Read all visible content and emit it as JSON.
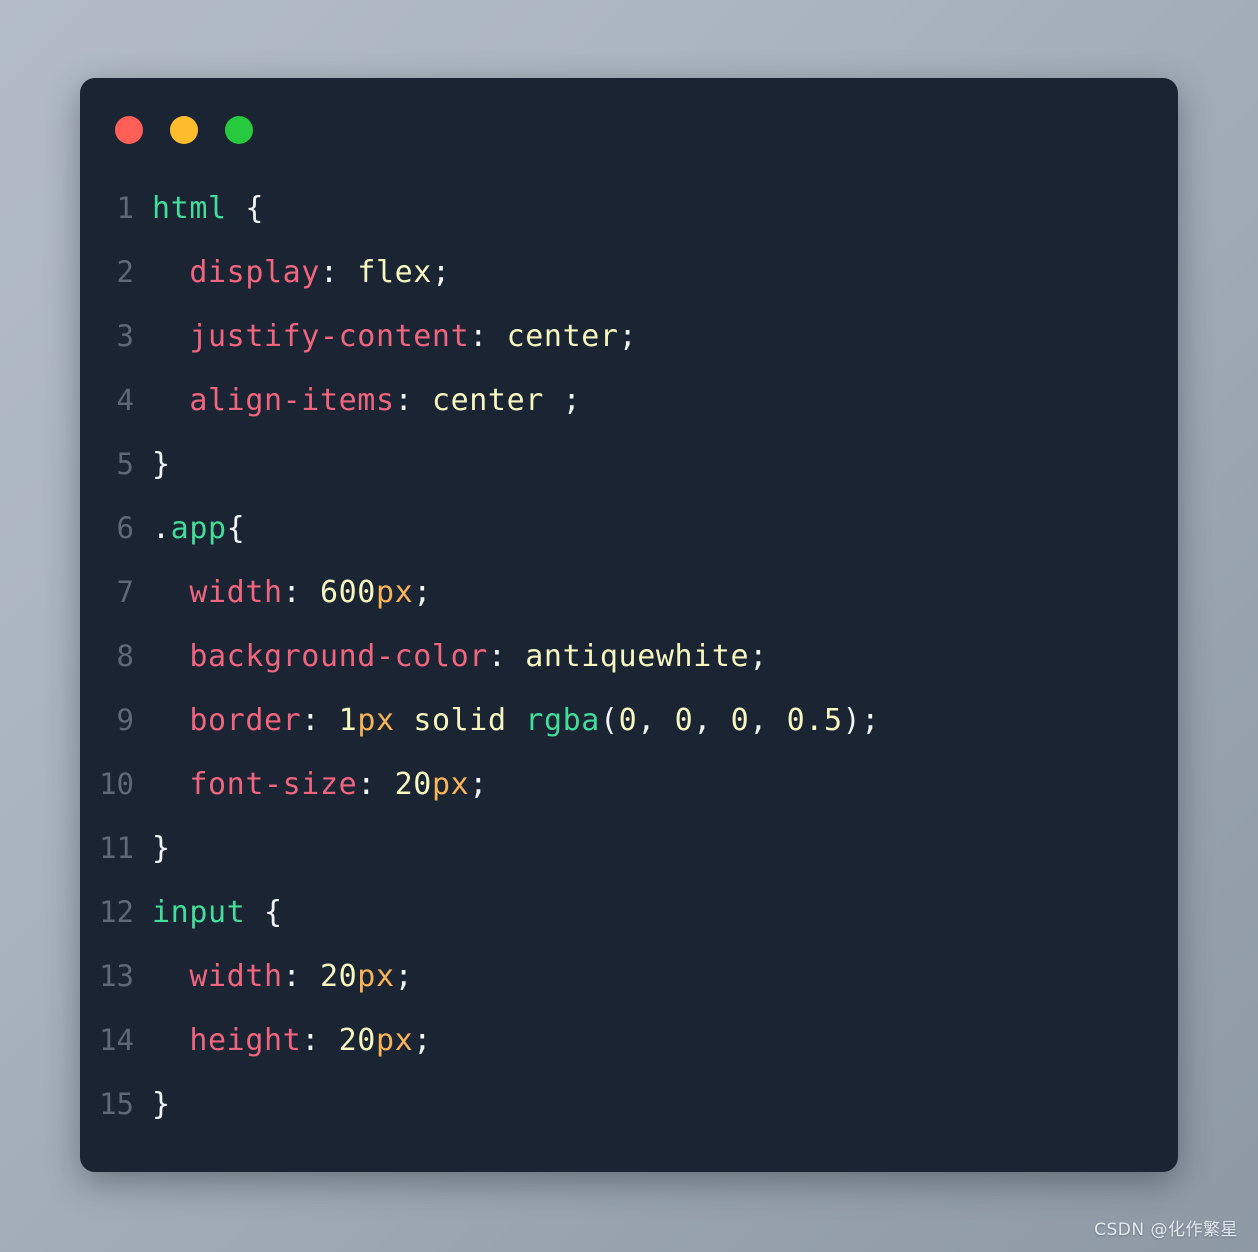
{
  "window": {
    "title_bar": {
      "dots": [
        {
          "name": "close-dot",
          "color": "#ff5f56"
        },
        {
          "name": "minimize-dot",
          "color": "#ffbd2e"
        },
        {
          "name": "maximize-dot",
          "color": "#27c93f"
        }
      ]
    },
    "background_color": "#1b2433",
    "page_background_color": "#a9b3be"
  },
  "syntax_colors": {
    "selector": "#43dd9b",
    "property": "#f0657e",
    "value": "#f6f8c0",
    "unit": "#f9b457",
    "function": "#43dd9b",
    "punctuation": "#f2f5f7",
    "line_number": "#5d6878"
  },
  "editor": {
    "language": "css",
    "lines": [
      {
        "number": "1",
        "plain": "html {",
        "tokens": [
          {
            "t": "html",
            "c": "tok-sel"
          },
          {
            "t": " {",
            "c": "tok-punc"
          }
        ]
      },
      {
        "number": "2",
        "plain": "  display: flex;",
        "tokens": [
          {
            "t": "  ",
            "c": "tok-plain"
          },
          {
            "t": "display",
            "c": "tok-prop"
          },
          {
            "t": ": ",
            "c": "tok-punc"
          },
          {
            "t": "flex",
            "c": "tok-val"
          },
          {
            "t": ";",
            "c": "tok-punc"
          }
        ]
      },
      {
        "number": "3",
        "plain": "  justify-content: center;",
        "tokens": [
          {
            "t": "  ",
            "c": "tok-plain"
          },
          {
            "t": "justify-content",
            "c": "tok-prop"
          },
          {
            "t": ": ",
            "c": "tok-punc"
          },
          {
            "t": "center",
            "c": "tok-val"
          },
          {
            "t": ";",
            "c": "tok-punc"
          }
        ]
      },
      {
        "number": "4",
        "plain": "  align-items: center ;",
        "tokens": [
          {
            "t": "  ",
            "c": "tok-plain"
          },
          {
            "t": "align-items",
            "c": "tok-prop"
          },
          {
            "t": ": ",
            "c": "tok-punc"
          },
          {
            "t": "center ",
            "c": "tok-val"
          },
          {
            "t": ";",
            "c": "tok-punc"
          }
        ]
      },
      {
        "number": "5",
        "plain": "}",
        "tokens": [
          {
            "t": "}",
            "c": "tok-punc"
          }
        ]
      },
      {
        "number": "6",
        "plain": ".app{",
        "tokens": [
          {
            "t": ".",
            "c": "tok-punc"
          },
          {
            "t": "app",
            "c": "tok-sel"
          },
          {
            "t": "{",
            "c": "tok-punc"
          }
        ]
      },
      {
        "number": "7",
        "plain": "  width: 600px;",
        "tokens": [
          {
            "t": "  ",
            "c": "tok-plain"
          },
          {
            "t": "width",
            "c": "tok-prop"
          },
          {
            "t": ": ",
            "c": "tok-punc"
          },
          {
            "t": "600",
            "c": "tok-val"
          },
          {
            "t": "px",
            "c": "tok-unit"
          },
          {
            "t": ";",
            "c": "tok-punc"
          }
        ]
      },
      {
        "number": "8",
        "plain": "  background-color: antiquewhite;",
        "tokens": [
          {
            "t": "  ",
            "c": "tok-plain"
          },
          {
            "t": "background-color",
            "c": "tok-prop"
          },
          {
            "t": ": ",
            "c": "tok-punc"
          },
          {
            "t": "antiquewhite",
            "c": "tok-val"
          },
          {
            "t": ";",
            "c": "tok-punc"
          }
        ]
      },
      {
        "number": "9",
        "plain": "  border: 1px solid rgba(0, 0, 0, 0.5);",
        "tokens": [
          {
            "t": "  ",
            "c": "tok-plain"
          },
          {
            "t": "border",
            "c": "tok-prop"
          },
          {
            "t": ": ",
            "c": "tok-punc"
          },
          {
            "t": "1",
            "c": "tok-val"
          },
          {
            "t": "px",
            "c": "tok-unit"
          },
          {
            "t": " ",
            "c": "tok-plain"
          },
          {
            "t": "solid",
            "c": "tok-val"
          },
          {
            "t": " ",
            "c": "tok-plain"
          },
          {
            "t": "rgba",
            "c": "tok-func"
          },
          {
            "t": "(",
            "c": "tok-punc"
          },
          {
            "t": "0",
            "c": "tok-val"
          },
          {
            "t": ", ",
            "c": "tok-punc"
          },
          {
            "t": "0",
            "c": "tok-val"
          },
          {
            "t": ", ",
            "c": "tok-punc"
          },
          {
            "t": "0",
            "c": "tok-val"
          },
          {
            "t": ", ",
            "c": "tok-punc"
          },
          {
            "t": "0.5",
            "c": "tok-val"
          },
          {
            "t": ");",
            "c": "tok-punc"
          }
        ]
      },
      {
        "number": "10",
        "plain": "  font-size: 20px;",
        "tokens": [
          {
            "t": "  ",
            "c": "tok-plain"
          },
          {
            "t": "font-size",
            "c": "tok-prop"
          },
          {
            "t": ": ",
            "c": "tok-punc"
          },
          {
            "t": "20",
            "c": "tok-val"
          },
          {
            "t": "px",
            "c": "tok-unit"
          },
          {
            "t": ";",
            "c": "tok-punc"
          }
        ]
      },
      {
        "number": "11",
        "plain": "}",
        "tokens": [
          {
            "t": "}",
            "c": "tok-punc"
          }
        ]
      },
      {
        "number": "12",
        "plain": "input {",
        "tokens": [
          {
            "t": "input",
            "c": "tok-sel"
          },
          {
            "t": " {",
            "c": "tok-punc"
          }
        ]
      },
      {
        "number": "13",
        "plain": "  width: 20px;",
        "tokens": [
          {
            "t": "  ",
            "c": "tok-plain"
          },
          {
            "t": "width",
            "c": "tok-prop"
          },
          {
            "t": ": ",
            "c": "tok-punc"
          },
          {
            "t": "20",
            "c": "tok-val"
          },
          {
            "t": "px",
            "c": "tok-unit"
          },
          {
            "t": ";",
            "c": "tok-punc"
          }
        ]
      },
      {
        "number": "14",
        "plain": "  height: 20px;",
        "tokens": [
          {
            "t": "  ",
            "c": "tok-plain"
          },
          {
            "t": "height",
            "c": "tok-prop"
          },
          {
            "t": ": ",
            "c": "tok-punc"
          },
          {
            "t": "20",
            "c": "tok-val"
          },
          {
            "t": "px",
            "c": "tok-unit"
          },
          {
            "t": ";",
            "c": "tok-punc"
          }
        ]
      },
      {
        "number": "15",
        "plain": "}",
        "tokens": [
          {
            "t": "}",
            "c": "tok-punc"
          }
        ]
      }
    ]
  },
  "watermark": {
    "text": "CSDN @化作繁星"
  }
}
